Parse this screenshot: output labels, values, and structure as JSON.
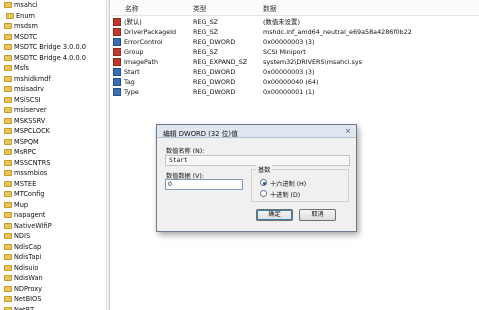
{
  "tree": {
    "items": [
      {
        "label": "msahci",
        "child": false
      },
      {
        "label": "Enum",
        "child": true
      },
      {
        "label": "msdsm",
        "child": false
      },
      {
        "label": "MSDTC",
        "child": false
      },
      {
        "label": "MSDTC Bridge 3.0.0.0",
        "child": false
      },
      {
        "label": "MSDTC Bridge 4.0.0.0",
        "child": false
      },
      {
        "label": "Msfs",
        "child": false
      },
      {
        "label": "mshidkmdf",
        "child": false
      },
      {
        "label": "msisadrv",
        "child": false
      },
      {
        "label": "MSiSCSI",
        "child": false
      },
      {
        "label": "msiserver",
        "child": false
      },
      {
        "label": "MSKSSRV",
        "child": false
      },
      {
        "label": "MSPCLOCK",
        "child": false
      },
      {
        "label": "MSPQM",
        "child": false
      },
      {
        "label": "MsRPC",
        "child": false
      },
      {
        "label": "MSSCNTRS",
        "child": false
      },
      {
        "label": "mssmbios",
        "child": false
      },
      {
        "label": "MSTEE",
        "child": false
      },
      {
        "label": "MTConfig",
        "child": false
      },
      {
        "label": "Mup",
        "child": false
      },
      {
        "label": "napagent",
        "child": false
      },
      {
        "label": "NativeWifiP",
        "child": false
      },
      {
        "label": "NDIS",
        "child": false
      },
      {
        "label": "NdisCap",
        "child": false
      },
      {
        "label": "NdisTapi",
        "child": false
      },
      {
        "label": "Ndisuio",
        "child": false
      },
      {
        "label": "NdisWan",
        "child": false
      },
      {
        "label": "NDProxy",
        "child": false
      },
      {
        "label": "NetBIOS",
        "child": false
      },
      {
        "label": "NetBT",
        "child": false
      }
    ]
  },
  "values": {
    "columns": {
      "name": "名称",
      "type": "类型",
      "data": "数据"
    },
    "rows": [
      {
        "icon": "sz",
        "icon_name": "string-value-icon",
        "name": "(默认)",
        "type": "REG_SZ",
        "data": "(数值未设置)"
      },
      {
        "icon": "sz",
        "icon_name": "string-value-icon",
        "name": "DriverPackageId",
        "type": "REG_SZ",
        "data": "mshdc.inf_amd64_neutral_e69a58a4286f0b22"
      },
      {
        "icon": "dword",
        "icon_name": "binary-value-icon",
        "name": "ErrorControl",
        "type": "REG_DWORD",
        "data": "0x00000003 (3)"
      },
      {
        "icon": "sz",
        "icon_name": "string-value-icon",
        "name": "Group",
        "type": "REG_SZ",
        "data": "SCSI Miniport"
      },
      {
        "icon": "sz",
        "icon_name": "string-value-icon",
        "name": "ImagePath",
        "type": "REG_EXPAND_SZ",
        "data": "system32\\DRIVERS\\msahci.sys"
      },
      {
        "icon": "dword",
        "icon_name": "binary-value-icon",
        "name": "Start",
        "type": "REG_DWORD",
        "data": "0x00000003 (3)"
      },
      {
        "icon": "dword",
        "icon_name": "binary-value-icon",
        "name": "Tag",
        "type": "REG_DWORD",
        "data": "0x00000040 (64)"
      },
      {
        "icon": "dword",
        "icon_name": "binary-value-icon",
        "name": "Type",
        "type": "REG_DWORD",
        "data": "0x00000001 (1)"
      }
    ]
  },
  "dialog": {
    "title": "编辑 DWORD (32 位)值",
    "close_glyph": "×",
    "name_label": "数值名称 (N):",
    "name_value": "Start",
    "data_label": "数值数据 (V):",
    "data_value": "0",
    "base_label": "基数",
    "hex_label": "十六进制 (H)",
    "dec_label": "十进制 (D)",
    "base_selected": "hex",
    "ok_label": "确定",
    "cancel_label": "取消"
  },
  "colors": {
    "accent": "#3c7fb1",
    "string_icon": "#c0392b",
    "dword_icon": "#3a6fb5",
    "folder": "#e7c55a"
  }
}
